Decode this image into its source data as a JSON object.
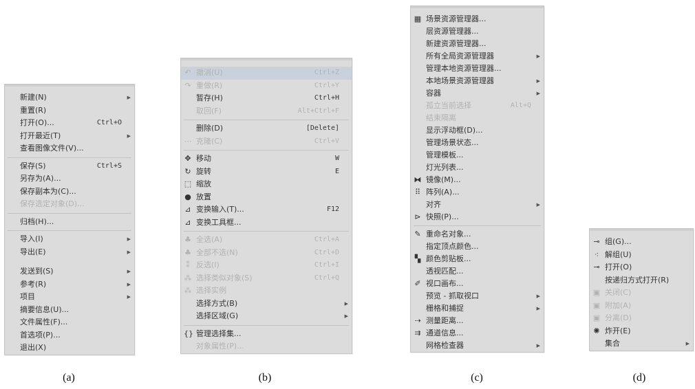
{
  "menu_a": {
    "items": [
      {
        "label": "新建(N)",
        "submenu": true
      },
      {
        "label": "重置(R)"
      },
      {
        "label": "打开(O)...",
        "shortcut": "Ctrl+O"
      },
      {
        "label": "打开最近(T)",
        "submenu": true
      },
      {
        "label": "查看图像文件(V)..."
      },
      {
        "sep": true
      },
      {
        "label": "保存(S)",
        "shortcut": "Ctrl+S"
      },
      {
        "label": "另存为(A)..."
      },
      {
        "label": "保存副本为(C)..."
      },
      {
        "label": "保存选定对象(D)...",
        "disabled": true
      },
      {
        "sep": true
      },
      {
        "label": "归档(H)..."
      },
      {
        "sep": true
      },
      {
        "label": "导入(I)",
        "submenu": true
      },
      {
        "label": "导出(E)",
        "submenu": true
      },
      {
        "gap": true
      },
      {
        "label": "发送到(S)",
        "submenu": true
      },
      {
        "label": "参考(R)",
        "submenu": true
      },
      {
        "label": "项目",
        "submenu": true
      },
      {
        "label": "摘要信息(U)..."
      },
      {
        "label": "文件属性(F)..."
      },
      {
        "label": "首选项(P)..."
      },
      {
        "label": "退出(X)"
      }
    ]
  },
  "menu_b": {
    "items": [
      {
        "label": "撤消(U)",
        "shortcut": "Ctrl+Z",
        "disabled": true,
        "icon": "undo-icon",
        "glyph": "↶",
        "highlight": true
      },
      {
        "label": "重做(R)",
        "shortcut": "Ctrl+Y",
        "disabled": true,
        "icon": "redo-icon",
        "glyph": "↷"
      },
      {
        "label": "暂存(H)",
        "shortcut": "Ctrl+H"
      },
      {
        "label": "取回(F)",
        "shortcut": "Alt+Ctrl+F",
        "disabled": true
      },
      {
        "sep": true
      },
      {
        "label": "删除(D)",
        "shortcut": "[Delete]"
      },
      {
        "label": "克隆(C)",
        "shortcut": "Ctrl+V",
        "disabled": true,
        "icon": "clone-icon",
        "glyph": "⋯"
      },
      {
        "sep": true
      },
      {
        "label": "移动",
        "shortcut": "W",
        "icon": "move-icon",
        "glyph": "✥"
      },
      {
        "label": "旋转",
        "shortcut": "E",
        "icon": "rotate-icon",
        "glyph": "↻"
      },
      {
        "label": "缩放",
        "icon": "scale-icon",
        "glyph": "⬚"
      },
      {
        "label": "放置",
        "icon": "place-icon",
        "glyph": "●"
      },
      {
        "label": "变换输入(T)...",
        "shortcut": "F12",
        "icon": "transform-input-icon",
        "glyph": "⊿"
      },
      {
        "label": "变换工具框...",
        "icon": "transform-toolbox-icon",
        "glyph": "⊿"
      },
      {
        "sep": true
      },
      {
        "label": "全选(A)",
        "shortcut": "Ctrl+A",
        "disabled": true,
        "icon": "select-all-icon",
        "glyph": "♣"
      },
      {
        "label": "全部不选(N)",
        "shortcut": "Ctrl+D",
        "disabled": true,
        "icon": "select-none-icon",
        "glyph": "♣"
      },
      {
        "label": "反选(I)",
        "shortcut": "Ctrl+I",
        "disabled": true,
        "icon": "select-invert-icon",
        "glyph": "⁑"
      },
      {
        "label": "选择类似对象(S)",
        "shortcut": "Ctrl+Q",
        "disabled": true,
        "icon": "select-similar-icon",
        "glyph": "⁂"
      },
      {
        "label": "选择实例",
        "disabled": true,
        "icon": "select-instance-icon",
        "glyph": "⁂"
      },
      {
        "label": "选择方式(B)",
        "submenu": true
      },
      {
        "label": "选择区域(G)",
        "submenu": true
      },
      {
        "sep": true
      },
      {
        "label": "管理选择集...",
        "icon": "manage-selection-icon",
        "glyph": "{}"
      },
      {
        "label": "对象属性(P)...",
        "disabled": true
      }
    ]
  },
  "menu_c": {
    "items": [
      {
        "label": "场景资源管理器...",
        "icon": "scene-explorer-icon",
        "glyph": "▦"
      },
      {
        "label": "层资源管理器..."
      },
      {
        "label": "新建资源管理器..."
      },
      {
        "label": "所有全局资源管理器",
        "submenu": true
      },
      {
        "label": "管理本地资源管理器..."
      },
      {
        "label": "本地场景资源管理器",
        "submenu": true
      },
      {
        "label": "容器",
        "submenu": true
      },
      {
        "label": "孤立当前选择",
        "shortcut": "Alt+Q",
        "disabled": true
      },
      {
        "label": "结束隔离",
        "disabled": true
      },
      {
        "label": "显示浮动框(D)..."
      },
      {
        "label": "管理场景状态..."
      },
      {
        "label": "管理模板..."
      },
      {
        "label": "灯光列表..."
      },
      {
        "label": "镜像(M)...",
        "icon": "mirror-icon",
        "glyph": "⧓"
      },
      {
        "label": "阵列(A)...",
        "icon": "array-icon",
        "glyph": "⠿"
      },
      {
        "label": "对齐",
        "submenu": true
      },
      {
        "label": "快照(P)...",
        "icon": "snapshot-icon",
        "glyph": "⊳"
      },
      {
        "sep": true
      },
      {
        "label": "重命名对象...",
        "icon": "rename-icon",
        "glyph": "✎"
      },
      {
        "label": "指定顶点颜色..."
      },
      {
        "label": "颜色剪贴板...",
        "icon": "color-clipboard-icon",
        "glyph": "▚"
      },
      {
        "label": "透视匹配..."
      },
      {
        "label": "视口画布...",
        "icon": "viewport-canvas-icon",
        "glyph": "✐"
      },
      {
        "label": "预览 - 抓取视口",
        "submenu": true
      },
      {
        "label": "栅格和捕捉",
        "submenu": true
      },
      {
        "label": "测量距离...",
        "icon": "measure-distance-icon",
        "glyph": "⇢"
      },
      {
        "label": "通道信息...",
        "icon": "channel-info-icon",
        "glyph": "⇉"
      },
      {
        "label": "网格检查器",
        "submenu": true
      }
    ]
  },
  "menu_d": {
    "items": [
      {
        "label": "组(G)...",
        "icon": "group-icon",
        "glyph": "⊸"
      },
      {
        "label": "解组(U)",
        "icon": "ungroup-icon",
        "glyph": "⁖"
      },
      {
        "label": "打开(O)",
        "icon": "open-group-icon",
        "glyph": "⊸"
      },
      {
        "label": "按递归方式打开(R)"
      },
      {
        "label": "关闭(C)",
        "disabled": true,
        "icon": "close-group-icon",
        "glyph": "▣"
      },
      {
        "label": "附加(A)",
        "disabled": true,
        "icon": "attach-icon",
        "glyph": "▣"
      },
      {
        "label": "分离(D)",
        "disabled": true,
        "icon": "detach-icon",
        "glyph": "▣"
      },
      {
        "label": "炸开(E)",
        "icon": "explode-icon",
        "glyph": "✺"
      },
      {
        "label": "集合",
        "submenu": true
      }
    ]
  },
  "captions": {
    "a": "(a)",
    "b": "(b)",
    "c": "(c)",
    "d": "(d)"
  },
  "colors": {
    "menu_bg": "#dcdcdc",
    "highlight": "#c9d2dc",
    "disabled_text": "#b2b2b2",
    "text": "#333333"
  }
}
